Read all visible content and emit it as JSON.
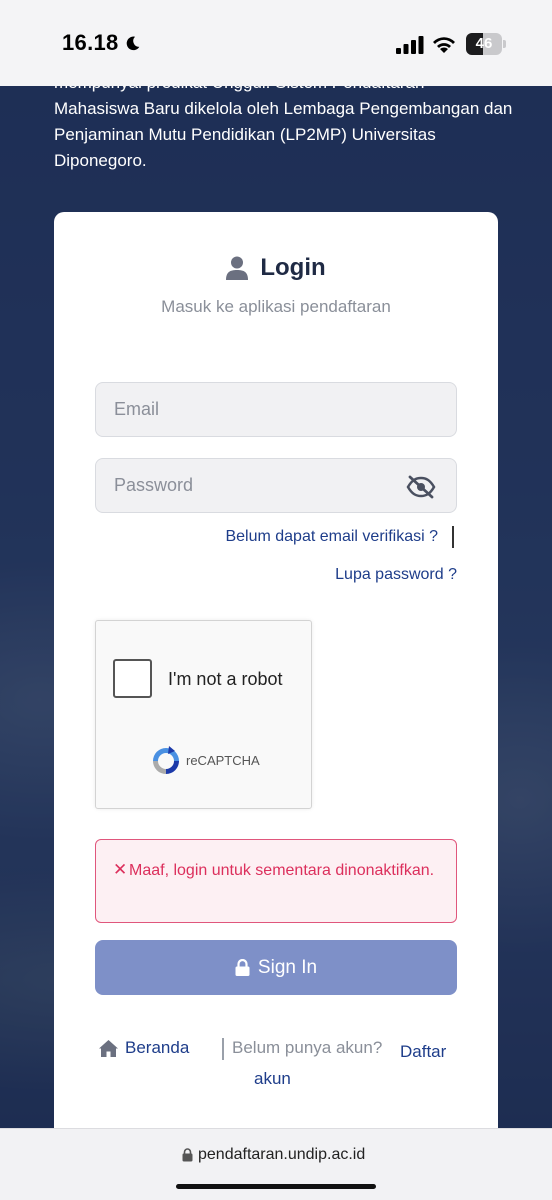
{
  "status_bar": {
    "time": "16.18",
    "battery_level": "46",
    "battery_fraction": 0.46
  },
  "intro": {
    "text": "mempunyai predikat Unggul. Sistem Pendaftaran Mahasiswa Baru dikelola oleh Lembaga Pengembangan dan Penjaminan Mutu Pendidikan (LP2MP) Universitas Diponegoro."
  },
  "login": {
    "title": "Login",
    "subtitle": "Masuk ke aplikasi pendaftaran",
    "email_placeholder": "Email",
    "password_placeholder": "Password",
    "verify_link": "Belum dapat email verifikasi ?",
    "forgot_link": "Lupa password ?",
    "recaptcha_label": "I'm not a robot",
    "recaptcha_brand": "reCAPTCHA",
    "error_message": "Maaf, login untuk sementara dinonaktifkan.",
    "signin_label": "Sign In"
  },
  "footer": {
    "home_link": "Beranda",
    "no_account_text": "Belum punya akun?",
    "register_link": "Daftar akun"
  },
  "browser": {
    "url": "pendaftaran.undip.ac.id"
  },
  "colors": {
    "primary": "#1e3d8a",
    "button": "#7e90c8",
    "error": "#dc2f5c",
    "background": "#2a3a5c"
  }
}
